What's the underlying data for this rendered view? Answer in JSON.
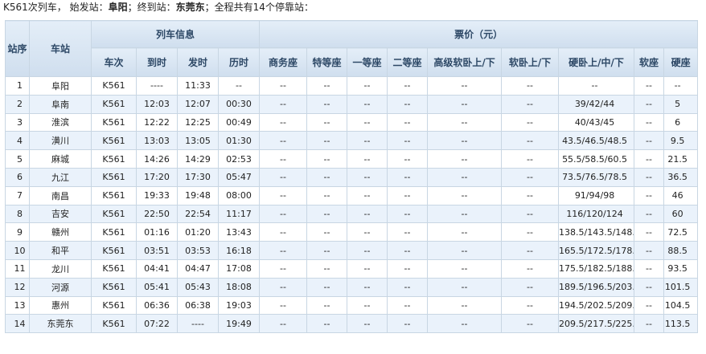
{
  "summary": {
    "train_prefix": "K561次列车，",
    "start_label": "始发站：",
    "start_station": "阜阳",
    "end_label": "；终到站：",
    "end_station": "东莞东",
    "stops_text": "；全程共有14个停靠站："
  },
  "headers": {
    "seq": "站序",
    "station": "车站",
    "train_info": "列车信息",
    "fare": "票价（元）",
    "train_no": "车次",
    "arrive": "到时",
    "depart": "发时",
    "duration": "历时",
    "business": "商务座",
    "special": "特等座",
    "first": "一等座",
    "second": "二等座",
    "deluxe_soft_sleeper": "高级软卧上/下",
    "soft_sleeper": "软卧上/下",
    "hard_sleeper": "硬卧上/中/下",
    "soft_seat": "软座",
    "hard_seat": "硬座"
  },
  "rows": [
    {
      "seq": "1",
      "station": "阜阳",
      "train": "K561",
      "arr": "----",
      "dep": "11:33",
      "dur": "--",
      "biz": "--",
      "spe": "--",
      "first": "--",
      "second": "--",
      "deluxe": "--",
      "soft": "--",
      "hard_sleeper": "--",
      "soft_seat": "--",
      "hard_seat": "--"
    },
    {
      "seq": "2",
      "station": "阜南",
      "train": "K561",
      "arr": "12:03",
      "dep": "12:07",
      "dur": "00:30",
      "biz": "--",
      "spe": "--",
      "first": "--",
      "second": "--",
      "deluxe": "--",
      "soft": "--",
      "hard_sleeper": "39/42/44",
      "soft_seat": "--",
      "hard_seat": "5"
    },
    {
      "seq": "3",
      "station": "淮滨",
      "train": "K561",
      "arr": "12:22",
      "dep": "12:25",
      "dur": "00:49",
      "biz": "--",
      "spe": "--",
      "first": "--",
      "second": "--",
      "deluxe": "--",
      "soft": "--",
      "hard_sleeper": "40/43/45",
      "soft_seat": "--",
      "hard_seat": "6"
    },
    {
      "seq": "4",
      "station": "潢川",
      "train": "K561",
      "arr": "13:03",
      "dep": "13:05",
      "dur": "01:30",
      "biz": "--",
      "spe": "--",
      "first": "--",
      "second": "--",
      "deluxe": "--",
      "soft": "--",
      "hard_sleeper": "43.5/46.5/48.5",
      "soft_seat": "--",
      "hard_seat": "9.5"
    },
    {
      "seq": "5",
      "station": "麻城",
      "train": "K561",
      "arr": "14:26",
      "dep": "14:29",
      "dur": "02:53",
      "biz": "--",
      "spe": "--",
      "first": "--",
      "second": "--",
      "deluxe": "--",
      "soft": "--",
      "hard_sleeper": "55.5/58.5/60.5",
      "soft_seat": "--",
      "hard_seat": "21.5"
    },
    {
      "seq": "6",
      "station": "九江",
      "train": "K561",
      "arr": "17:20",
      "dep": "17:30",
      "dur": "05:47",
      "biz": "--",
      "spe": "--",
      "first": "--",
      "second": "--",
      "deluxe": "--",
      "soft": "--",
      "hard_sleeper": "73.5/76.5/78.5",
      "soft_seat": "--",
      "hard_seat": "36.5"
    },
    {
      "seq": "7",
      "station": "南昌",
      "train": "K561",
      "arr": "19:33",
      "dep": "19:48",
      "dur": "08:00",
      "biz": "--",
      "spe": "--",
      "first": "--",
      "second": "--",
      "deluxe": "--",
      "soft": "--",
      "hard_sleeper": "91/94/98",
      "soft_seat": "--",
      "hard_seat": "46"
    },
    {
      "seq": "8",
      "station": "吉安",
      "train": "K561",
      "arr": "22:50",
      "dep": "22:54",
      "dur": "11:17",
      "biz": "--",
      "spe": "--",
      "first": "--",
      "second": "--",
      "deluxe": "--",
      "soft": "--",
      "hard_sleeper": "116/120/124",
      "soft_seat": "--",
      "hard_seat": "60"
    },
    {
      "seq": "9",
      "station": "赣州",
      "train": "K561",
      "arr": "01:16",
      "dep": "01:20",
      "dur": "13:43",
      "biz": "--",
      "spe": "--",
      "first": "--",
      "second": "--",
      "deluxe": "--",
      "soft": "--",
      "hard_sleeper": "138.5/143.5/148.",
      "soft_seat": "--",
      "hard_seat": "72.5"
    },
    {
      "seq": "10",
      "station": "和平",
      "train": "K561",
      "arr": "03:51",
      "dep": "03:53",
      "dur": "16:18",
      "biz": "--",
      "spe": "--",
      "first": "--",
      "second": "--",
      "deluxe": "--",
      "soft": "--",
      "hard_sleeper": "165.5/172.5/178.",
      "soft_seat": "--",
      "hard_seat": "88.5"
    },
    {
      "seq": "11",
      "station": "龙川",
      "train": "K561",
      "arr": "04:41",
      "dep": "04:47",
      "dur": "17:08",
      "biz": "--",
      "spe": "--",
      "first": "--",
      "second": "--",
      "deluxe": "--",
      "soft": "--",
      "hard_sleeper": "175.5/182.5/188.",
      "soft_seat": "--",
      "hard_seat": "93.5"
    },
    {
      "seq": "12",
      "station": "河源",
      "train": "K561",
      "arr": "05:41",
      "dep": "05:43",
      "dur": "18:08",
      "biz": "--",
      "spe": "--",
      "first": "--",
      "second": "--",
      "deluxe": "--",
      "soft": "--",
      "hard_sleeper": "189.5/196.5/203.",
      "soft_seat": "--",
      "hard_seat": "101.5"
    },
    {
      "seq": "13",
      "station": "惠州",
      "train": "K561",
      "arr": "06:36",
      "dep": "06:38",
      "dur": "19:03",
      "biz": "--",
      "spe": "--",
      "first": "--",
      "second": "--",
      "deluxe": "--",
      "soft": "--",
      "hard_sleeper": "194.5/202.5/209.",
      "soft_seat": "--",
      "hard_seat": "104.5"
    },
    {
      "seq": "14",
      "station": "东莞东",
      "train": "K561",
      "arr": "07:22",
      "dep": "----",
      "dur": "19:49",
      "biz": "--",
      "spe": "--",
      "first": "--",
      "second": "--",
      "deluxe": "--",
      "soft": "--",
      "hard_sleeper": "209.5/217.5/225.",
      "soft_seat": "--",
      "hard_seat": "113.5"
    }
  ]
}
